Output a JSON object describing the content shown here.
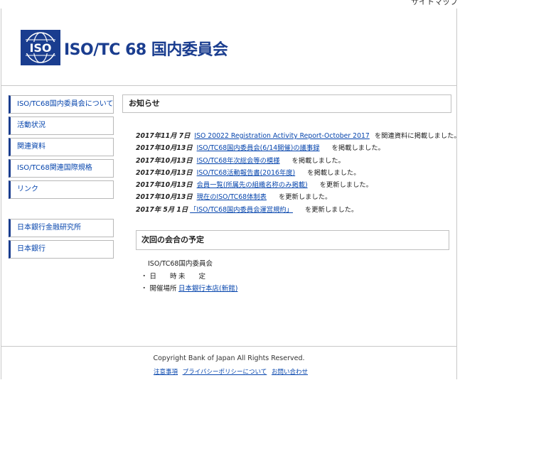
{
  "top_crumb": "サイトマップ",
  "header": {
    "logo_text": "ISO",
    "title": "ISO/TC 68 国内委員会"
  },
  "sidebar": {
    "items": [
      {
        "label": "ISO/TC68国内委員会について"
      },
      {
        "label": "活動状況"
      },
      {
        "label": "関連資料"
      },
      {
        "label": "ISO/TC68関連国際規格"
      },
      {
        "label": "リンク"
      }
    ],
    "external": [
      {
        "label": "日本銀行金融研究所"
      },
      {
        "label": "日本銀行"
      }
    ]
  },
  "news": {
    "heading": "お知らせ",
    "items": [
      {
        "date": "2017年11月 7日",
        "link": "ISO 20022 Registration Activity Report-October 2017",
        "suffix": "を関連資料に掲載しました。"
      },
      {
        "date": "2017年10月13日",
        "link": "ISO/TC68国内委員会(6/14開催)の議事録",
        "suffix": "を掲載しました。"
      },
      {
        "date": "2017年10月13日",
        "link": "ISO/TC68年次総会等の模様",
        "suffix": "を掲載しました。"
      },
      {
        "date": "2017年10月13日",
        "link": "ISO/TC68活動報告書(2016年度)",
        "suffix": "を掲載しました。"
      },
      {
        "date": "2017年10月13日",
        "link": "会員一覧(所属先の組織名称のみ掲載)",
        "suffix": "を更新しました。"
      },
      {
        "date": "2017年10月13日",
        "link": "現在のISO/TC68体制表",
        "suffix": "を更新しました。"
      },
      {
        "date": "2017年 5月 1日",
        "link": "「ISO/TC68国内委員会運営規約」",
        "suffix": "を更新しました。"
      }
    ]
  },
  "meeting": {
    "heading": "次回の会合の予定",
    "name": "ISO/TC68国内委員会",
    "date_label": "・ 日　　時",
    "date_value": "未　　定",
    "place_label": "・ 開催場所",
    "place_value": "日本銀行本店(新館)"
  },
  "footer": {
    "copyright": "Copyright Bank of Japan All Rights Reserved.",
    "links": [
      "注意事項",
      "プライバシーポリシーについて",
      "お問い合わせ"
    ]
  },
  "colors": {
    "brand_blue": "#1a3d8f",
    "link": "#0645ad",
    "border": "#c8c8c8"
  }
}
